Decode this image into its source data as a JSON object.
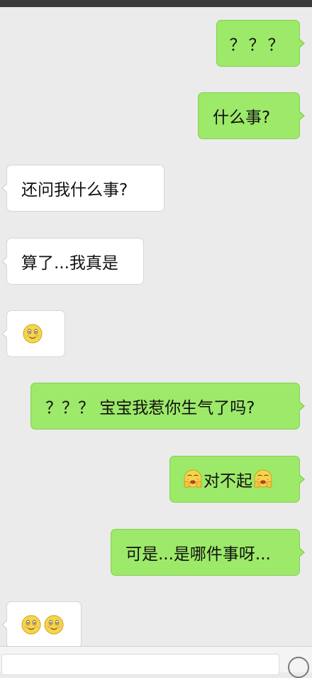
{
  "messages": [
    {
      "side": "right",
      "text": "？？？"
    },
    {
      "side": "right",
      "text": "什么事?"
    },
    {
      "side": "left",
      "text": "还问我什么事?"
    },
    {
      "side": "left",
      "text": "算了...我真是"
    },
    {
      "side": "left",
      "emoji": [
        "smile-icon"
      ]
    },
    {
      "side": "right",
      "text": "？？？ 宝宝我惹你生气了吗?"
    },
    {
      "side": "right",
      "prefix_emoji": "worried-face-icon",
      "text": "对不起",
      "suffix_emoji": "worried-face-icon"
    },
    {
      "side": "right",
      "text": "可是...是哪件事呀..."
    },
    {
      "side": "left",
      "emoji": [
        "smile-icon",
        "smile-icon"
      ]
    }
  ],
  "colors": {
    "background": "#ebebeb",
    "incoming_bubble": "#ffffff",
    "outgoing_bubble": "#9de969",
    "top_bar": "#3b3b3b"
  }
}
